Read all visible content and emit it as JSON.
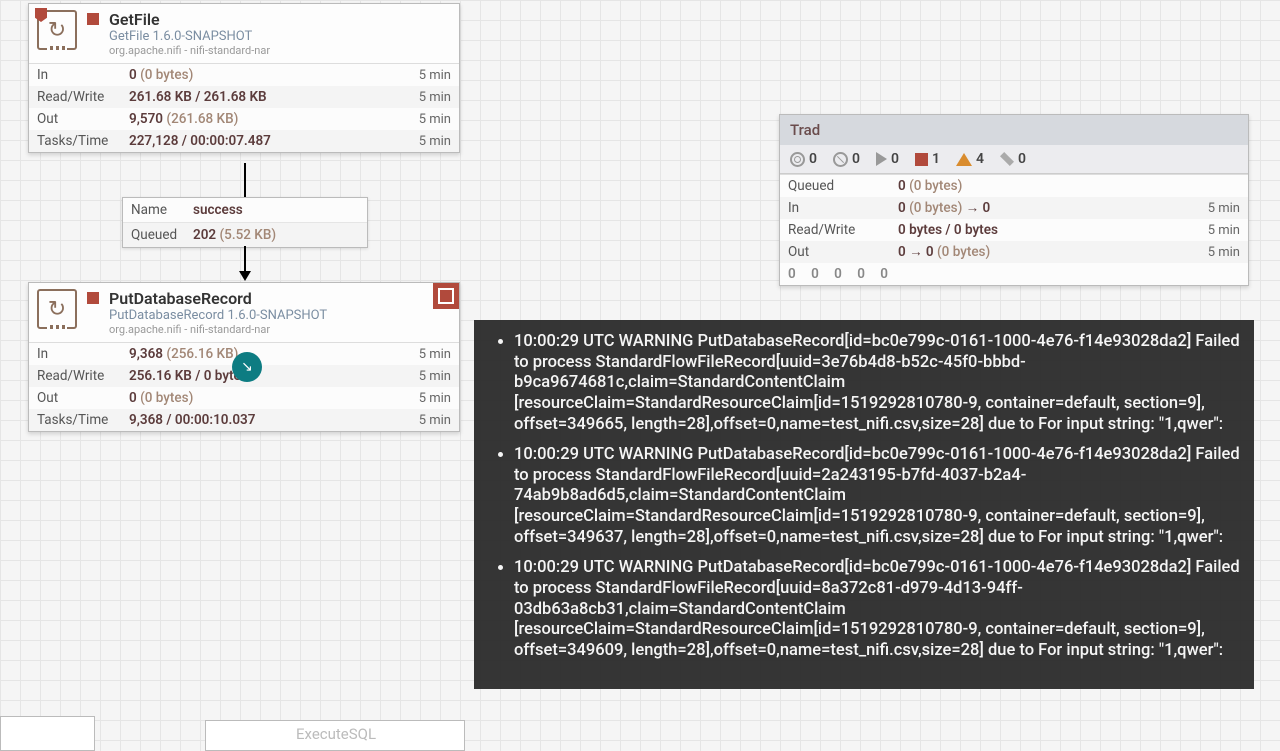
{
  "processors": {
    "getfile": {
      "title": "GetFile",
      "subtitle": "GetFile 1.6.0-SNAPSHOT",
      "bundle": "org.apache.nifi - nifi-standard-nar",
      "stats": {
        "in": "0",
        "in_paren": "(0 bytes)",
        "rw": "261.68 KB / 261.68 KB",
        "out": "9,570",
        "out_paren": "(261.68 KB)",
        "tasks": "227,128 / 00:00:07.487",
        "window": "5 min"
      }
    },
    "putdb": {
      "title": "PutDatabaseRecord",
      "subtitle": "PutDatabaseRecord 1.6.0-SNAPSHOT",
      "bundle": "org.apache.nifi - nifi-standard-nar",
      "stats": {
        "in": "9,368",
        "in_paren": "(256.16 KB)",
        "rw": "256.16 KB / 0 bytes",
        "out": "0",
        "out_paren": "(0 bytes)",
        "tasks": "9,368 / 00:00:10.037",
        "window": "5 min"
      }
    },
    "hint": "ExecuteSQL"
  },
  "connection": {
    "name_label": "Name",
    "name_value": "success",
    "queued_label": "Queued",
    "queued_value": "202",
    "queued_paren": "(5.52 KB)"
  },
  "labels": {
    "in": "In",
    "rw": "Read/Write",
    "out": "Out",
    "tasks": "Tasks/Time"
  },
  "pgroup": {
    "title": "Trad",
    "counts": {
      "transmitting": "0",
      "not_transmitting": "0",
      "running": "0",
      "stopped": "1",
      "invalid": "4",
      "disabled": "0"
    },
    "stats": {
      "queued_label": "Queued",
      "queued": "0",
      "queued_paren": "(0 bytes)",
      "in": "0",
      "in_paren": "(0 bytes)",
      "in_arrow": "→ 0",
      "rw": "0 bytes / 0 bytes",
      "out": "0 → 0",
      "out_paren": "(0 bytes)",
      "window": "5 min"
    },
    "footer_counts": "0    0    0    0    0"
  },
  "bulletins": [
    "10:00:29 UTC  WARNING PutDatabaseRecord[id=bc0e799c-0161-1000-4e76-f14e93028da2] Failed to process StandardFlowFileRecord[uuid=3e76b4d8-b52c-45f0-bbbd-b9ca9674681c,claim=StandardContentClaim [resourceClaim=StandardResourceClaim[id=1519292810780-9, container=default, section=9], offset=349665, length=28],offset=0,name=test_nifi.csv,size=28] due to For input string: \"1,qwer\":",
    "10:00:29 UTC  WARNING PutDatabaseRecord[id=bc0e799c-0161-1000-4e76-f14e93028da2] Failed to process StandardFlowFileRecord[uuid=2a243195-b7fd-4037-b2a4-74ab9b8ad6d5,claim=StandardContentClaim [resourceClaim=StandardResourceClaim[id=1519292810780-9, container=default, section=9], offset=349637, length=28],offset=0,name=test_nifi.csv,size=28] due to For input string: \"1,qwer\":",
    "10:00:29 UTC  WARNING PutDatabaseRecord[id=bc0e799c-0161-1000-4e76-f14e93028da2] Failed to process StandardFlowFileRecord[uuid=8a372c81-d979-4d13-94ff-03db63a8cb31,claim=StandardContentClaim [resourceClaim=StandardResourceClaim[id=1519292810780-9, container=default, section=9], offset=349609, length=28],offset=0,name=test_nifi.csv,size=28] due to For input string: \"1,qwer\":"
  ]
}
